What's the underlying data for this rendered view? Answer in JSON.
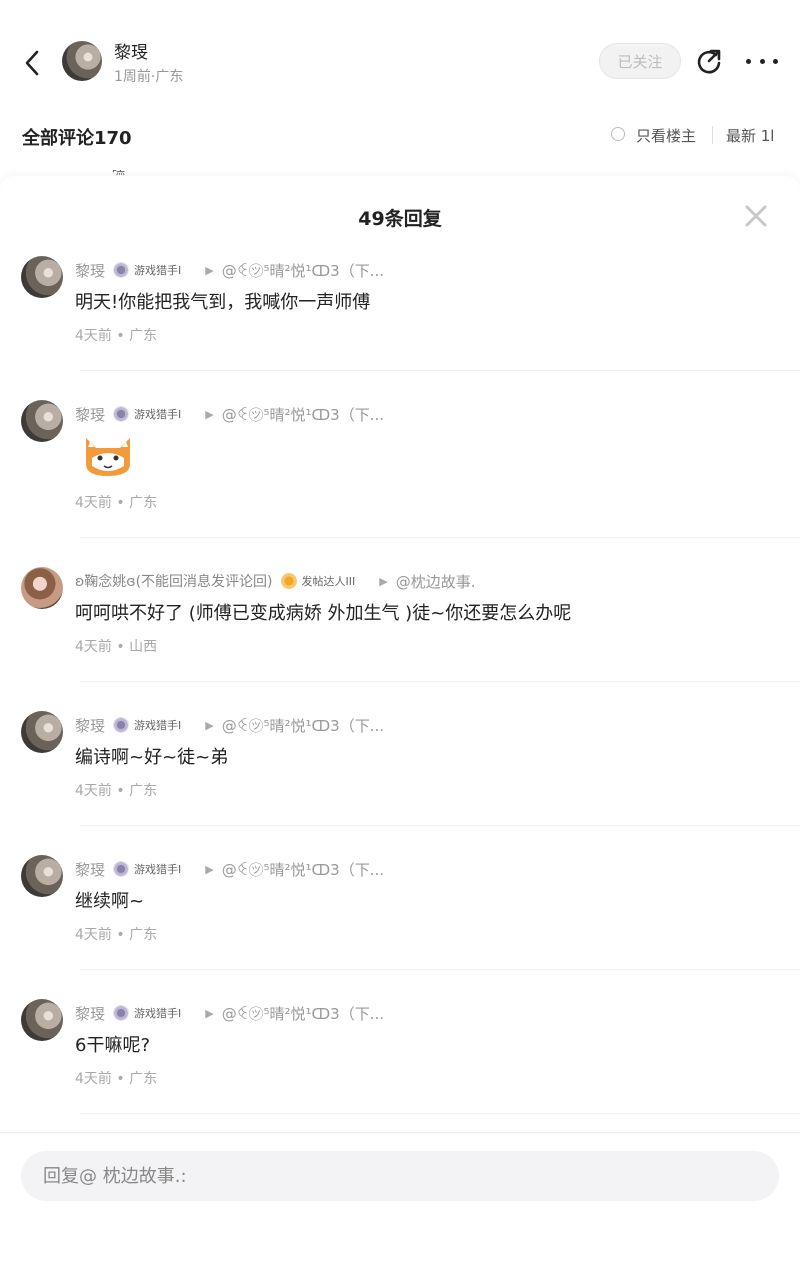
{
  "header": {
    "name": "黎琝",
    "sub": "1周前·广东",
    "follow_label": "已关注"
  },
  "comments": {
    "title": "全部评论170",
    "only_owner": "只看楼主",
    "sort": "最新 1l"
  },
  "sheet": {
    "title": "49条回复"
  },
  "replies": [
    {
      "name": "黎琝",
      "badge": "游戏猎手I",
      "target": "@ꒊ㋡⁵晴²悦¹ↀ3（下...",
      "body": "明天!你能把我气到，我喊你一声师傅",
      "time": "4天前 • 广东"
    },
    {
      "name": "黎琝",
      "badge": "游戏猎手I",
      "target": "@ꒊ㋡⁵晴²悦¹ↀ3（下...",
      "body": "",
      "time": "4天前 • 广东",
      "emoji": "cat-sticker"
    },
    {
      "name": "ʚ鞠念姚ɞ(不能回消息发评论回)",
      "badge": "发帖达人III",
      "target": "@枕边故事.",
      "body": "呵呵哄不好了 (师傅已变成病娇 外加生气 )徒~你还要怎么办呢",
      "time": "4天前 • 山西"
    },
    {
      "name": "黎琝",
      "badge": "游戏猎手I",
      "target": "@ꒊ㋡⁵晴²悦¹ↀ3（下...",
      "body": "编诗啊~好~徒~弟",
      "time": "4天前 • 广东"
    },
    {
      "name": "黎琝",
      "badge": "游戏猎手I",
      "target": "@ꒊ㋡⁵晴²悦¹ↀ3（下...",
      "body": "继续啊~",
      "time": "4天前 • 广东"
    },
    {
      "name": "黎琝",
      "badge": "游戏猎手I",
      "target": "@ꒊ㋡⁵晴²悦¹ↀ3（下...",
      "body": "6干嘛呢?",
      "time": "4天前 • 广东"
    }
  ],
  "input": {
    "placeholder": "回复@ 枕边故事.:"
  }
}
